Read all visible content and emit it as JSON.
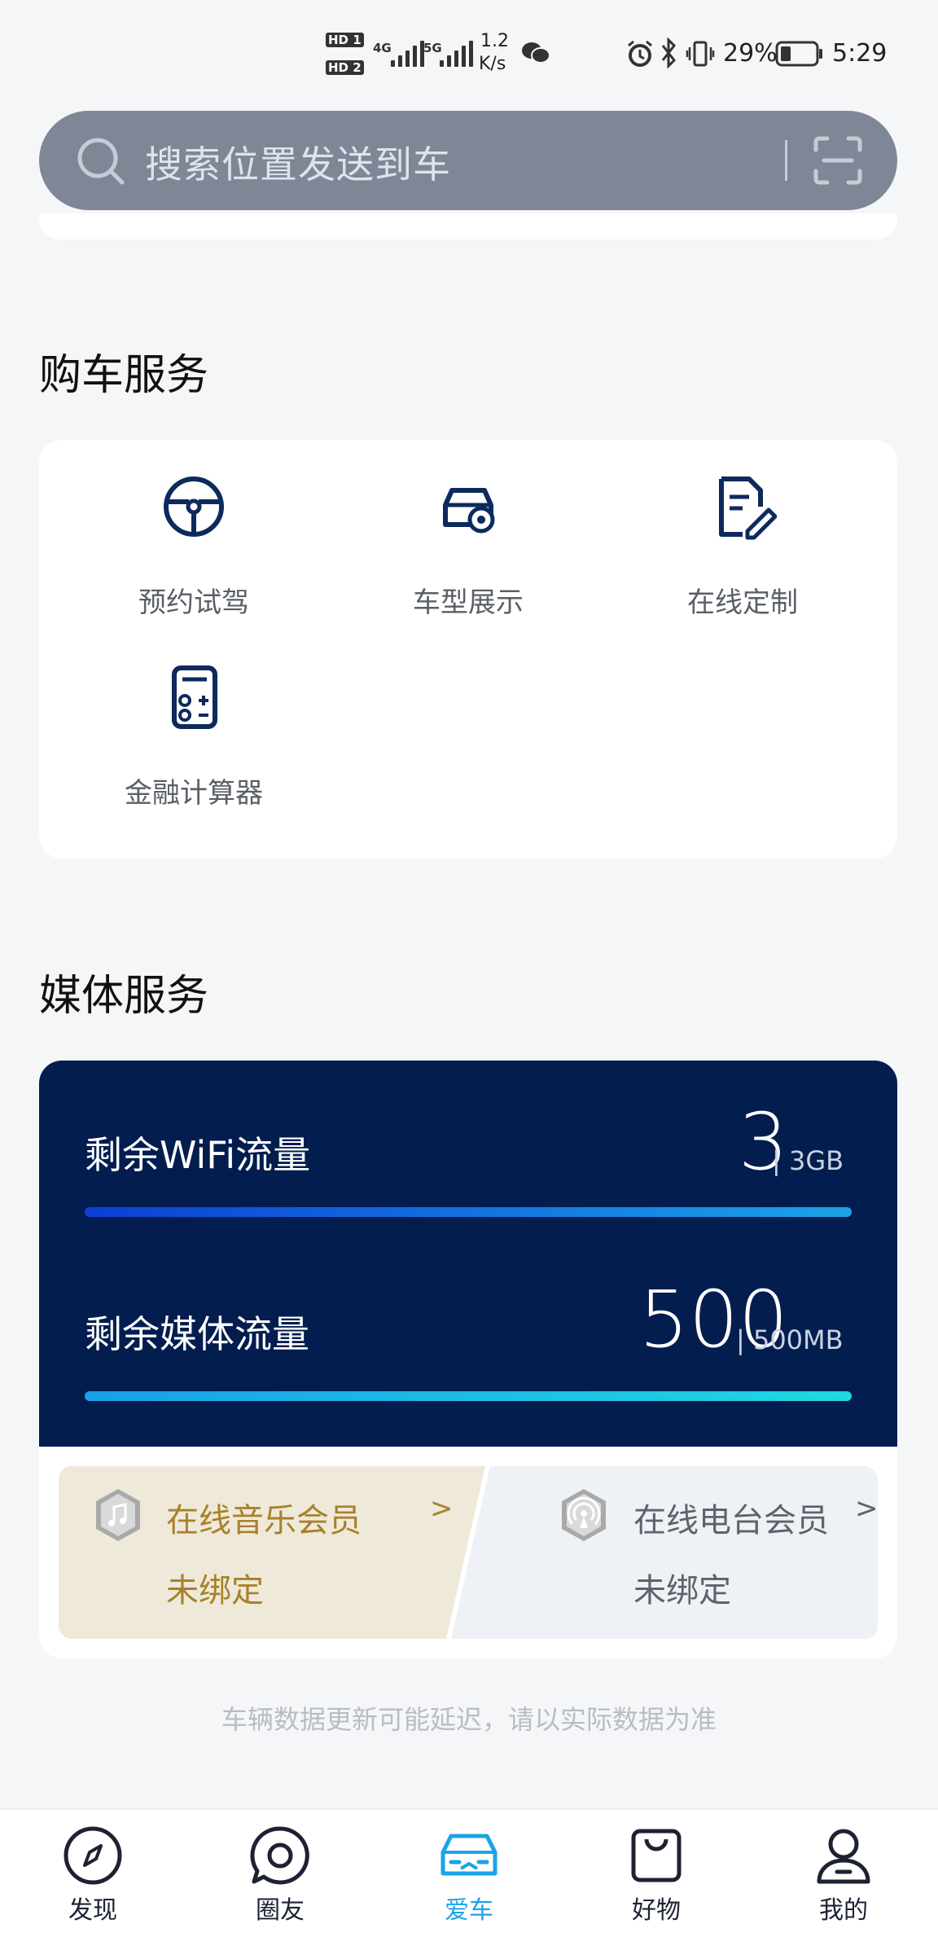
{
  "status_bar": {
    "net_speed_value": "1.2",
    "net_speed_unit": "K/s",
    "battery_percent": "29%",
    "time": "5:29",
    "hd1": "HD 1",
    "hd2": "HD 2",
    "net_4g": "4G",
    "net_5g": "5G"
  },
  "search": {
    "placeholder": "搜索位置发送到车"
  },
  "purchase_services": {
    "title": "购车服务",
    "items": [
      {
        "label": "预约试驾",
        "icon": "steering-wheel-icon"
      },
      {
        "label": "车型展示",
        "icon": "car-view-icon"
      },
      {
        "label": "在线定制",
        "icon": "document-edit-icon"
      },
      {
        "label": "金融计算器",
        "icon": "calculator-icon"
      }
    ]
  },
  "media_services": {
    "title": "媒体服务",
    "wifi": {
      "label": "剩余WiFi流量",
      "value": "3",
      "unit": "| 3GB",
      "fraction_remaining": 1.0
    },
    "media": {
      "label": "剩余媒体流量",
      "value": "500",
      "unit": "| 500MB",
      "fraction_remaining": 1.0
    },
    "music": {
      "title": "在线音乐会员",
      "chevron": ">",
      "status": "未绑定",
      "icon": "music-note-icon"
    },
    "radio": {
      "title": "在线电台会员",
      "chevron": ">",
      "status": "未绑定",
      "icon": "radio-broadcast-icon"
    }
  },
  "disclaimer": "车辆数据更新可能延迟，请以实际数据为准",
  "colors": {
    "accent": "#1aa3e8",
    "dark_panel": "#031d4e",
    "gold": "#a7822a"
  },
  "tabbar": {
    "active": "爱车",
    "items": [
      {
        "label": "发现",
        "icon": "compass-icon"
      },
      {
        "label": "圈友",
        "icon": "chat-circle-icon"
      },
      {
        "label": "爱车",
        "icon": "car-icon"
      },
      {
        "label": "好物",
        "icon": "shopping-bag-icon"
      },
      {
        "label": "我的",
        "icon": "person-icon"
      }
    ]
  }
}
